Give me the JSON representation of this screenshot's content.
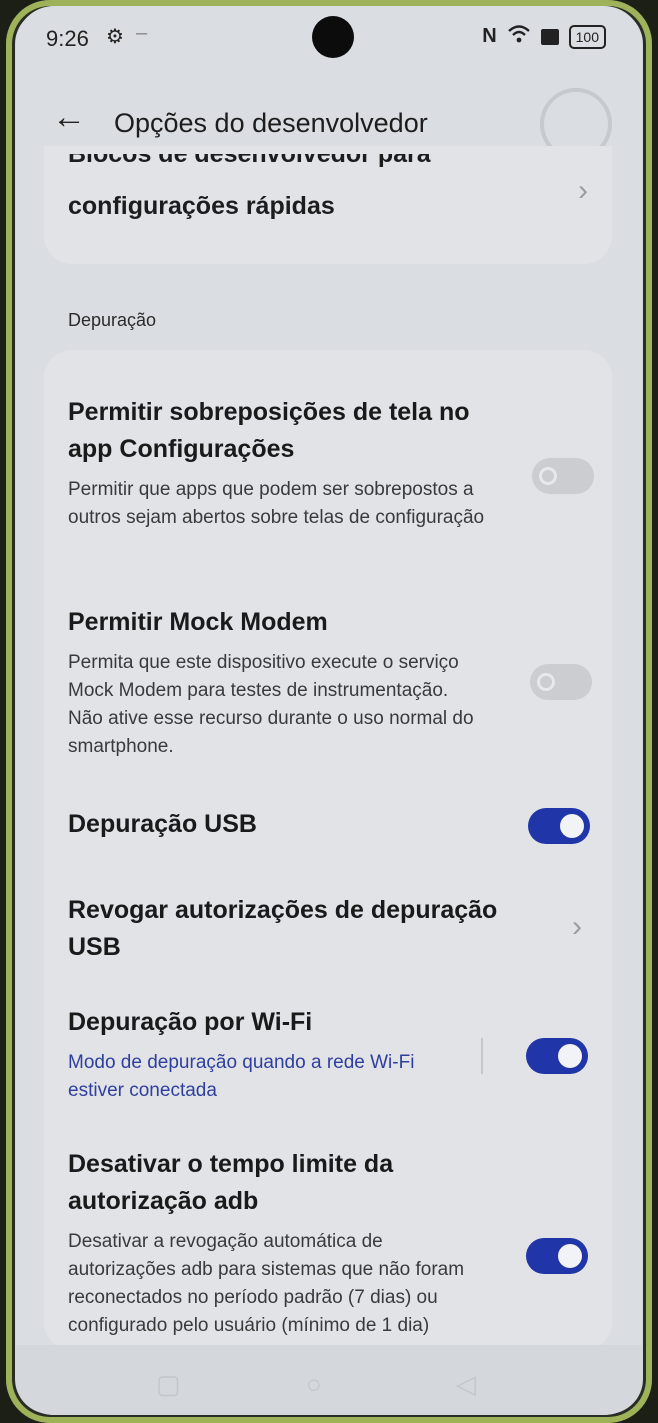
{
  "status_bar": {
    "time": "9:26",
    "battery": "100"
  },
  "header": {
    "title": "Opções do desenvolvedor"
  },
  "top_card": {
    "line1": "Blocos de desenvolvedor para",
    "line2": "configurações rápidas"
  },
  "section": {
    "label": "Depuração"
  },
  "settings": [
    {
      "title": "Permitir sobreposições de tela no app Configurações",
      "description": "Permitir que apps que podem ser sobrepostos a outros sejam abertos sobre telas de configuração",
      "toggle": "off"
    },
    {
      "title": "Permitir Mock Modem",
      "description": "Permita que este dispositivo execute o serviço Mock Modem para testes de instrumentação. Não ative esse recurso durante o uso normal do smartphone.",
      "toggle": "off"
    },
    {
      "title": "Depuração USB",
      "toggle": "on"
    },
    {
      "title": "Revogar autorizações de depuração USB"
    },
    {
      "title": "Depuração por Wi-Fi",
      "description": "Modo de depuração quando a rede Wi-Fi estiver conectada",
      "toggle": "on"
    },
    {
      "title": "Desativar o tempo limite da autorização adb",
      "description": "Desativar a revogação automática de autorizações adb para sistemas que não foram reconectados no período padrão (7 dias) ou configurado pelo usuário (mínimo de 1 dia)",
      "toggle": "on"
    }
  ],
  "colors": {
    "toggle_on": "#1f35a8",
    "link_blue": "#2f3f9d"
  }
}
